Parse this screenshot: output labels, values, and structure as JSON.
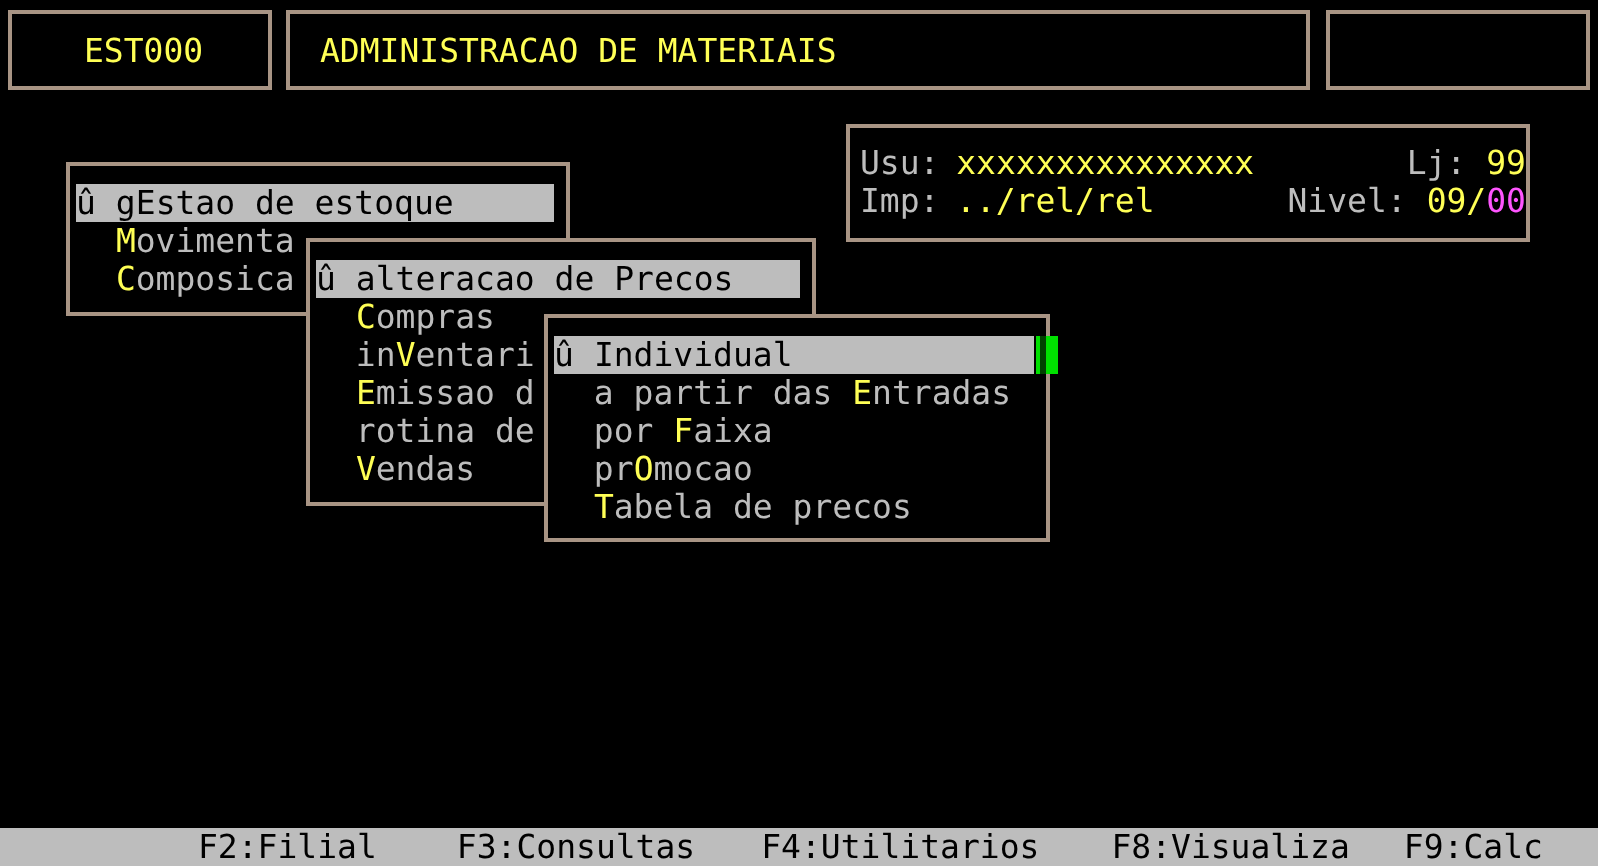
{
  "header": {
    "code": "EST000",
    "title": "ADMINISTRACAO DE MATERIAIS"
  },
  "info": {
    "user_label": "Usu:",
    "user": "xxxxxxxxxxxxxxx",
    "store_label": "Lj:",
    "store": "99",
    "printer_label": "Imp:",
    "printer": "../rel/rel",
    "level_label": "Nivel:",
    "level_a": "09",
    "level_sep": "/",
    "level_b": "00"
  },
  "menus": [
    {
      "items": [
        {
          "marker": "û",
          "pre": "g",
          "key": "E",
          "post": "stao de estoque",
          "selected": true
        },
        {
          "key": "M",
          "post": "ovimenta",
          "selected": false
        },
        {
          "key": "C",
          "post": "omposica",
          "selected": false
        }
      ]
    },
    {
      "items": [
        {
          "marker": "û",
          "pre": "alteracao de ",
          "key": "P",
          "post": "recos",
          "selected": true
        },
        {
          "key": "C",
          "post": "ompras",
          "selected": false
        },
        {
          "pre": "in",
          "key": "V",
          "post": "entari",
          "selected": false
        },
        {
          "key": "E",
          "post": "missao d",
          "selected": false
        },
        {
          "pre": "rotina de",
          "selected": false
        },
        {
          "key": "V",
          "post": "endas",
          "selected": false
        }
      ]
    },
    {
      "items": [
        {
          "marker": "û",
          "key": "I",
          "post": "ndividual",
          "selected": true
        },
        {
          "pre": "a partir das ",
          "key": "E",
          "post": "ntradas",
          "selected": false
        },
        {
          "pre": "por ",
          "key": "F",
          "post": "aixa",
          "selected": false
        },
        {
          "pre": "pr",
          "key": "O",
          "post": "mocao",
          "selected": false
        },
        {
          "key": "T",
          "post": "abela de precos",
          "selected": false
        }
      ]
    }
  ],
  "function_keys": [
    "F2:Filial",
    "F3:Consultas",
    "F4:Utilitarios",
    "F8:Visualiza",
    "F9:Calc"
  ]
}
